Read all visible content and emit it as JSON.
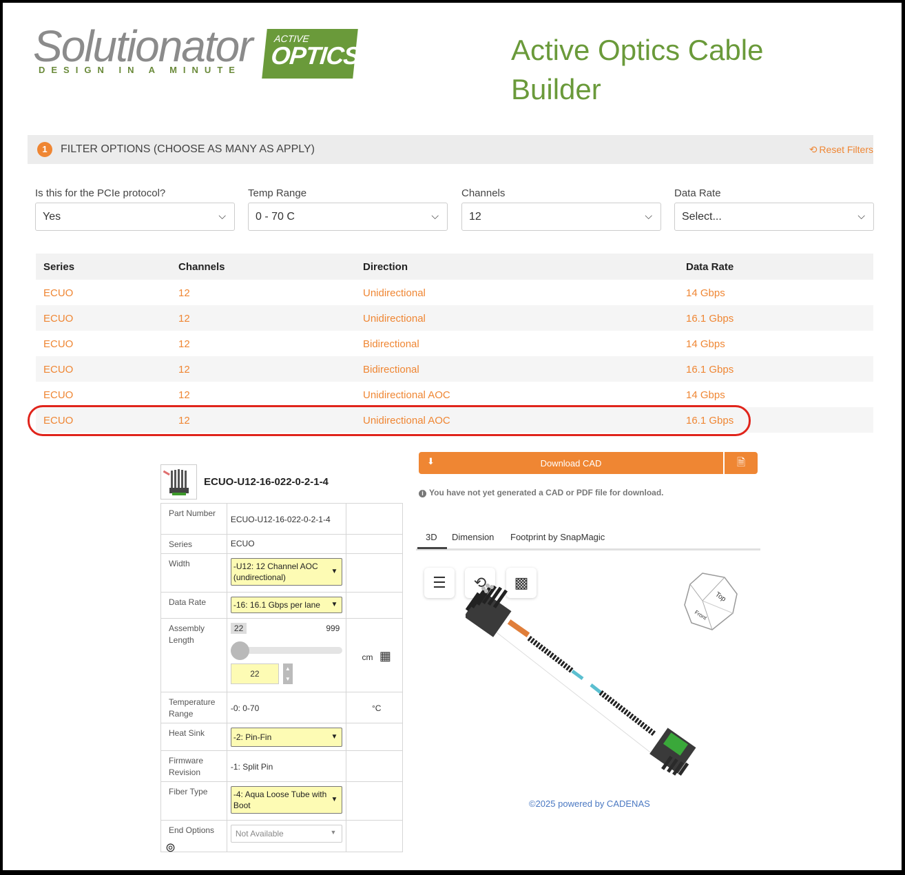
{
  "header": {
    "logo_word": "Solutionator",
    "logo_tagline": "DESIGN IN A MINUTE",
    "logo_badge_top": "ACTIVE",
    "logo_badge_main": "OPTICS",
    "title": "Active Optics Cable Builder"
  },
  "filter": {
    "step": "1",
    "title": "FILTER OPTIONS (CHOOSE AS MANY AS APPLY)",
    "reset_label": "Reset Filters",
    "fields": [
      {
        "label": "Is this for the PCIe protocol?",
        "value": "Yes"
      },
      {
        "label": "Temp Range",
        "value": "0 - 70 C"
      },
      {
        "label": "Channels",
        "value": "12"
      },
      {
        "label": "Data Rate",
        "value": "Select..."
      }
    ]
  },
  "results": {
    "headers": [
      "Series",
      "Channels",
      "Direction",
      "Data Rate"
    ],
    "rows": [
      [
        "ECUO",
        "12",
        "Unidirectional",
        "14 Gbps"
      ],
      [
        "ECUO",
        "12",
        "Unidirectional",
        "16.1 Gbps"
      ],
      [
        "ECUO",
        "12",
        "Bidirectional",
        "14 Gbps"
      ],
      [
        "ECUO",
        "12",
        "Bidirectional",
        "16.1 Gbps"
      ],
      [
        "ECUO",
        "12",
        "Unidirectional AOC",
        "14 Gbps"
      ],
      [
        "ECUO",
        "12",
        "Unidirectional AOC",
        "16.1 Gbps"
      ]
    ],
    "highlighted_row": 5,
    "highlight_color": "#e0241b"
  },
  "product": {
    "name": "ECUO-U12-16-022-0-2-1-4",
    "rows": {
      "part_number": {
        "label": "Part Number",
        "value": "ECUO-U12-16-022-0-2-1-4"
      },
      "series": {
        "label": "Series",
        "value": "ECUO"
      },
      "width": {
        "label": "Width",
        "value": "-U12: 12 Channel AOC (undirectional)"
      },
      "data_rate": {
        "label": "Data Rate",
        "value": "-16: 16.1 Gbps per lane"
      },
      "assembly_length": {
        "label": "Assembly Length",
        "min": "22",
        "max": "999",
        "value": "22",
        "unit": "cm",
        "level": 0
      },
      "temperature": {
        "label": "Temperature Range",
        "value": "-0: 0-70",
        "unit": "°C"
      },
      "heat_sink": {
        "label": "Heat Sink",
        "value": "-2: Pin-Fin"
      },
      "firmware": {
        "label": "Firmware Revision",
        "value": "-1: Split Pin"
      },
      "fiber_type": {
        "label": "Fiber Type",
        "value": "-4: Aqua Loose Tube with Boot"
      },
      "end_options": {
        "label": "End Options",
        "value": "Not Available"
      }
    }
  },
  "viewer": {
    "download_label": "Download CAD",
    "note": "You have not yet generated a CAD or PDF file for download.",
    "tabs": [
      "3D",
      "Dimension",
      "Footprint by SnapMagic"
    ],
    "active_tab": "3D",
    "cube_top": "Top",
    "cube_front": "Front",
    "powered_by": "©2025 powered by CADENAS"
  },
  "colors": {
    "accent": "#ef8633",
    "brand_green": "#6a9a3a",
    "link_blue": "#4a78c2"
  }
}
